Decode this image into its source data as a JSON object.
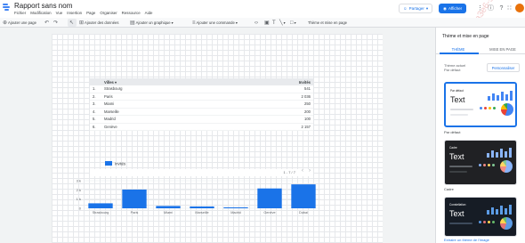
{
  "header": {
    "doc_title": "Rapport sans nom",
    "menu": [
      "Fichier",
      "Modification",
      "Vue",
      "Insertion",
      "Page",
      "Organiser",
      "Ressource",
      "Aide"
    ],
    "share_label": "Partager",
    "view_label": "Afficher",
    "watermark": "633ea3e6-9bf4-4f23-a4ec-aa64e2cdc3e0",
    "icons": [
      "person-add-icon",
      "visibility-icon",
      "info-icon",
      "grid-apps-icon",
      "avatar"
    ]
  },
  "toolbar": {
    "add_page": "Ajouter une page",
    "add_data": "Ajouter des données",
    "add_chart": "Ajouter un graphique",
    "add_control": "Ajouter une commande",
    "theme_layout": "Thème et mise en page"
  },
  "table": {
    "headers": [
      "Villes",
      "Invités"
    ],
    "rows": [
      {
        "num": "1.",
        "city": "Strasbourg",
        "value": "541"
      },
      {
        "num": "2.",
        "city": "Paris",
        "value": "2 036"
      },
      {
        "num": "3.",
        "city": "Miami",
        "value": "250"
      },
      {
        "num": "4.",
        "city": "Marseille",
        "value": "200"
      },
      {
        "num": "5.",
        "city": "Madrid",
        "value": "100"
      },
      {
        "num": "6.",
        "city": "Genève",
        "value": "2 157"
      }
    ],
    "pagination": "1 - 7 / 7"
  },
  "chart_data": {
    "type": "bar",
    "legend": "Invités",
    "categories": [
      "Strasbourg",
      "Paris",
      "Miami",
      "Marseille",
      "Madrid",
      "Genève",
      "Dubai"
    ],
    "values": [
      541,
      2036,
      250,
      200,
      100,
      2157,
      2600
    ],
    "yticks": [
      "3 k",
      "2 k",
      "1 k",
      "0"
    ],
    "ylim": [
      0,
      3000
    ],
    "color": "#1a73e8"
  },
  "panel": {
    "title": "Thème et mise en page",
    "tabs": [
      "THÈME",
      "MISE EN PAGE"
    ],
    "current_label": "Thème actuel",
    "current_value": "Par défaut",
    "customize": "Personnaliser",
    "themes": [
      {
        "name": "Par défaut",
        "card_title": "Par défaut",
        "sample": "Text",
        "bg": "#ffffff",
        "fg": "#202124"
      },
      {
        "name": "Cadre",
        "card_title": "Cadre",
        "sample": "Text",
        "bg": "#202124",
        "fg": "#ffffff"
      },
      {
        "name": "Constellation",
        "card_title": "Constellation",
        "sample": "Text",
        "bg": "#161c25",
        "fg": "#ffffff"
      }
    ],
    "link": "Extraire un thème de l'image"
  }
}
